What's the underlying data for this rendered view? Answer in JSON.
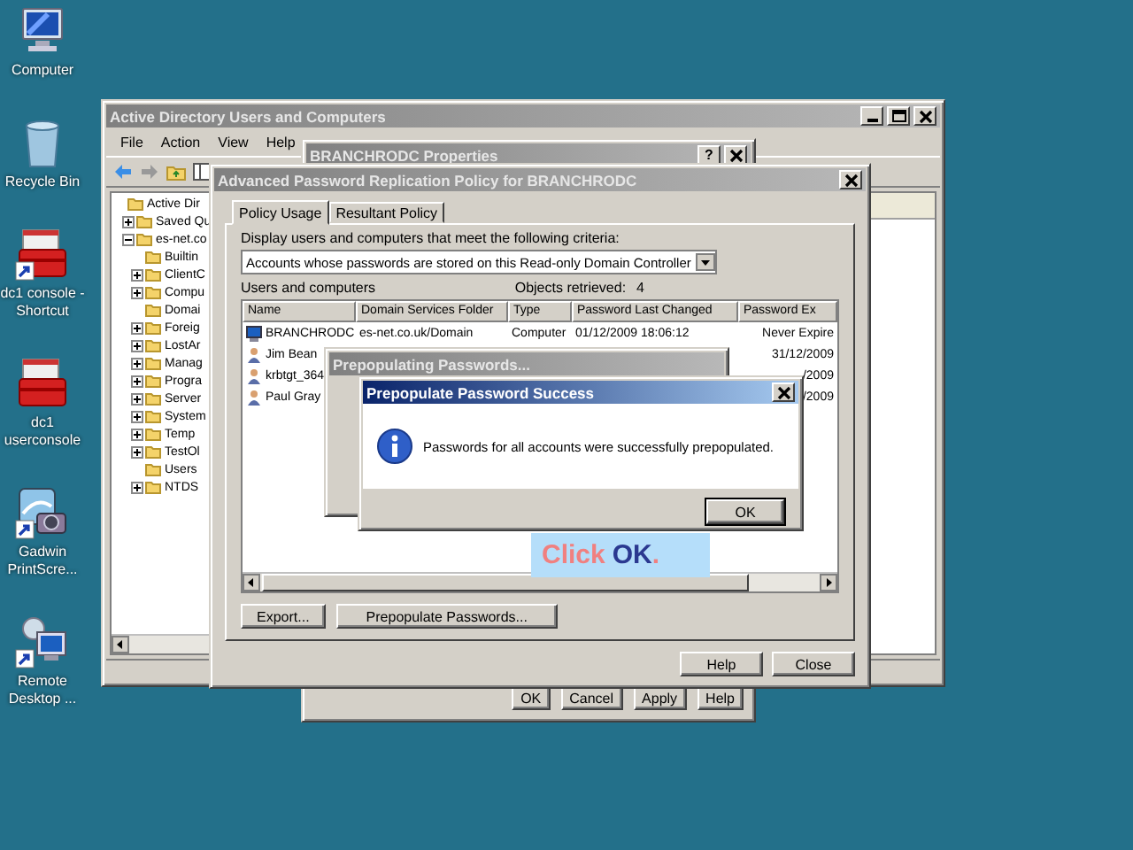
{
  "desktop_icons": [
    {
      "label": "Computer",
      "kind": "computer",
      "shortcut": false
    },
    {
      "label": "Recycle Bin",
      "kind": "recycle-bin",
      "shortcut": false
    },
    {
      "label": "dc1 console - Shortcut",
      "kind": "toolbox",
      "shortcut": true
    },
    {
      "label": "dc1 userconsole",
      "kind": "toolbox",
      "shortcut": false
    },
    {
      "label": "Gadwin PrintScre...",
      "kind": "camera",
      "shortcut": true
    },
    {
      "label": "Remote Desktop ...",
      "kind": "remote",
      "shortcut": true
    }
  ],
  "aduc_window": {
    "title": "Active Directory Users and Computers",
    "active": false,
    "title_buttons": [
      {
        "kind": "minimize"
      },
      {
        "kind": "maximize"
      },
      {
        "kind": "close"
      }
    ],
    "menu": [
      "File",
      "Action",
      "View",
      "Help"
    ],
    "tree": [
      {
        "label": "Active Dir",
        "children": [
          {
            "label": "Saved Qu",
            "expanded": false
          },
          {
            "label": "es-net.co",
            "expanded": true,
            "children": [
              {
                "label": "Builtin"
              },
              {
                "label": "ClientC",
                "expanded": false
              },
              {
                "label": "Compu",
                "expanded": false
              },
              {
                "label": "Domai"
              },
              {
                "label": "Foreig",
                "expanded": false
              },
              {
                "label": "LostAr",
                "expanded": false
              },
              {
                "label": "Manag",
                "expanded": false
              },
              {
                "label": "Progra",
                "expanded": false
              },
              {
                "label": "Server",
                "expanded": false
              },
              {
                "label": "System",
                "expanded": false
              },
              {
                "label": "Temp",
                "expanded": false
              },
              {
                "label": "TestOl",
                "expanded": false
              },
              {
                "label": "Users"
              },
              {
                "label": "NTDS",
                "expanded": false
              }
            ]
          }
        ]
      }
    ]
  },
  "properties_window": {
    "title": "BRANCHRODC Properties",
    "active": false,
    "title_buttons": [
      {
        "kind": "help",
        "glyph": "?"
      },
      {
        "kind": "close"
      }
    ],
    "buttons": [
      "OK",
      "Cancel",
      "Apply",
      "Help"
    ]
  },
  "policy_window": {
    "title": "Advanced Password Replication Policy for BRANCHRODC",
    "active": false,
    "title_buttons": [
      {
        "kind": "close"
      }
    ],
    "tabs": [
      {
        "label": "Policy Usage",
        "selected": true
      },
      {
        "label": "Resultant Policy",
        "selected": false
      }
    ],
    "criteria_label": "Display users and computers that meet the following criteria:",
    "criteria_value": "Accounts whose passwords are stored on this Read-only Domain Controller",
    "list_label": "Users and computers",
    "objects_label": "Objects retrieved:",
    "objects_count": "4",
    "columns": [
      "Name",
      "Domain Services Folder",
      "Type",
      "Password Last Changed",
      "Password Ex"
    ],
    "rows": [
      {
        "kind": "computer",
        "name": "BRANCHRODC",
        "folder": "es-net.co.uk/Domain",
        "type": "Computer",
        "changed": "01/12/2009 18:06:12",
        "expires": "Never Expire"
      },
      {
        "kind": "user",
        "name": "Jim Bean",
        "expires": "31/12/2009"
      },
      {
        "kind": "user",
        "name": "krbtgt_364",
        "expires": "/2009"
      },
      {
        "kind": "user",
        "name": "Paul Gray",
        "expires": "/2009"
      }
    ],
    "buttons": [
      "Export...",
      "Prepopulate Passwords..."
    ],
    "footer_buttons": [
      "Help",
      "Close"
    ]
  },
  "progress_window": {
    "title": "Prepopulating Passwords...",
    "active": false
  },
  "success_dialog": {
    "title": "Prepopulate Password Success",
    "active": true,
    "title_buttons": [
      {
        "kind": "close"
      }
    ],
    "message": "Passwords for all accounts were successfully prepopulated.",
    "button": "OK"
  },
  "callout": {
    "parts": [
      {
        "text": "Click",
        "color": "#f08080"
      },
      {
        "text": "OK",
        "color": "#2b3990"
      },
      {
        "text": ".",
        "color": "#f08080"
      }
    ]
  }
}
